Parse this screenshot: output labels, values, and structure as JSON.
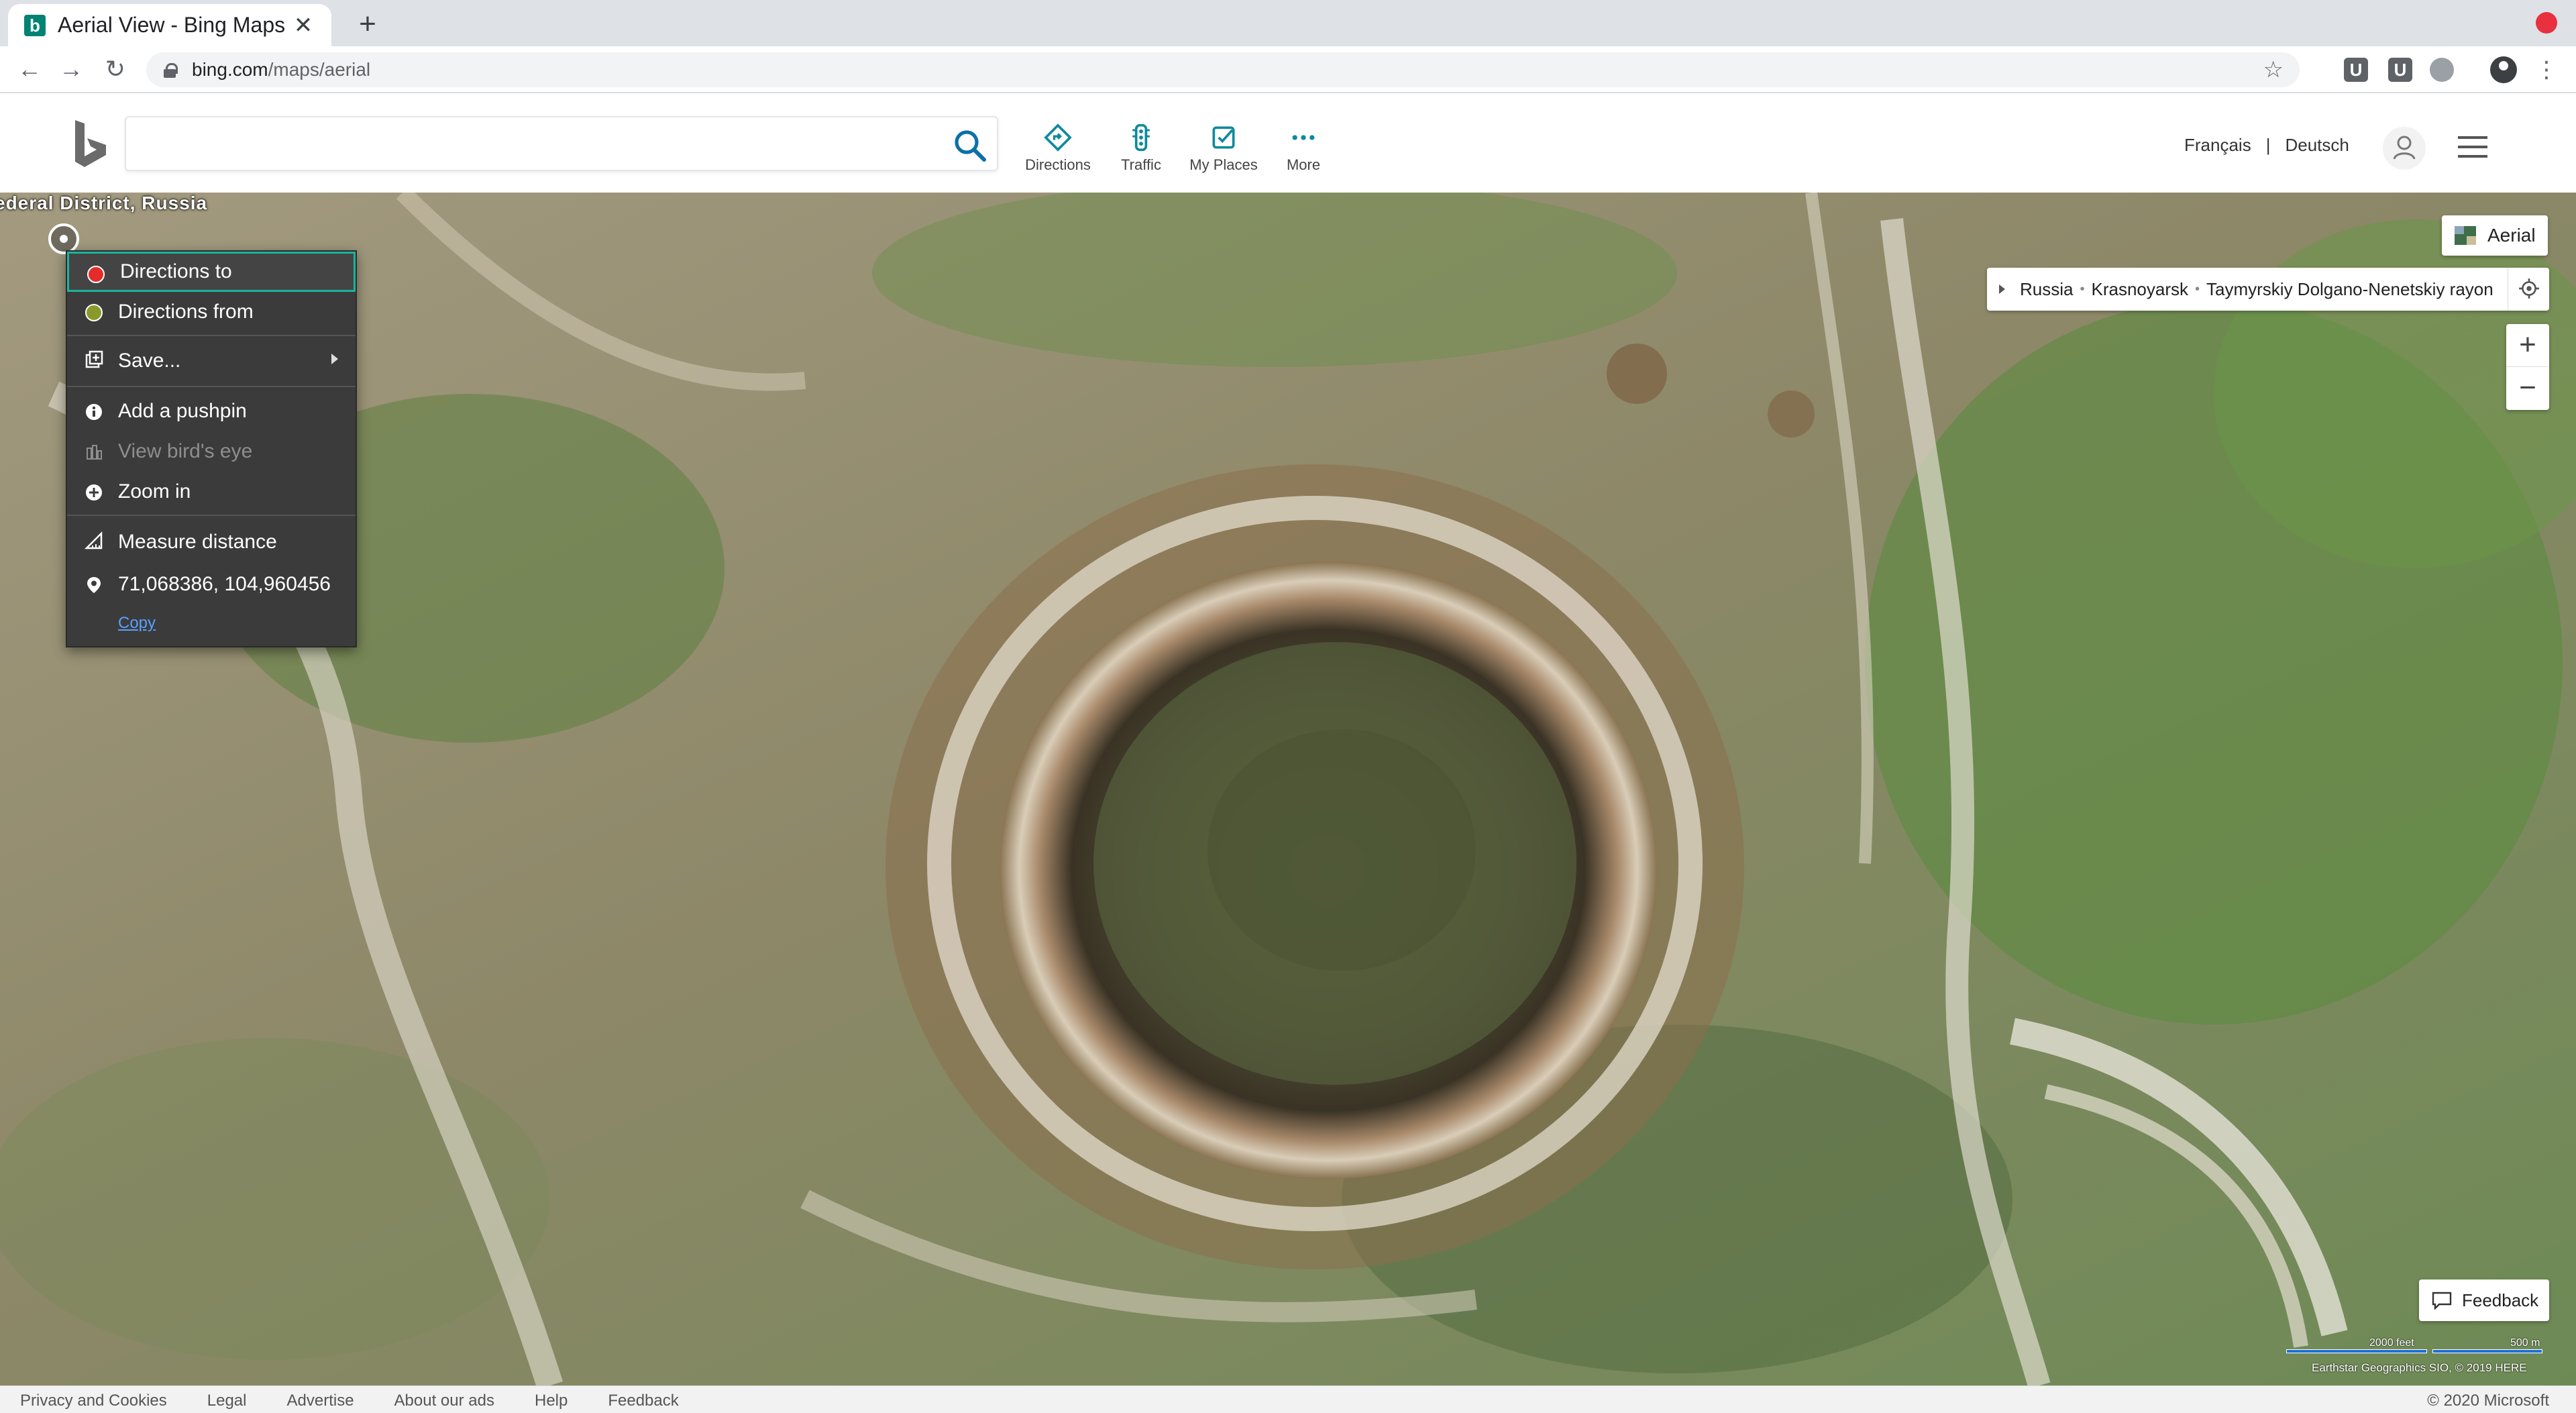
{
  "browser": {
    "tab_title": "Aerial View - Bing Maps",
    "tab_favicon": "b",
    "new_tab_icon": "plus-icon",
    "url_host": "bing.com",
    "url_path": "/maps/aerial",
    "extensions": [
      "U",
      "U"
    ]
  },
  "header": {
    "search_placeholder": "",
    "nav": [
      {
        "label": "Directions",
        "icon": "directions-icon"
      },
      {
        "label": "Traffic",
        "icon": "traffic-icon"
      },
      {
        "label": "My Places",
        "icon": "my-places-icon"
      },
      {
        "label": "More",
        "icon": "more-icon"
      }
    ],
    "languages": [
      "Français",
      "|",
      "Deutsch"
    ]
  },
  "map": {
    "region_label": "ederal District, Russia",
    "view_mode": "Aerial",
    "breadcrumb": [
      "Russia",
      "Krasnoyarsk",
      "Taymyrskiy Dolgano-Nenetskiy rayon"
    ],
    "breadcrumb_separator": "•",
    "zoom_in": "+",
    "zoom_out": "−",
    "feedback": "Feedback",
    "scale_label_1": "2000 feet",
    "scale_label_2": "500 m",
    "attribution": "Earthstar Geographics SIO, © 2019 HERE"
  },
  "context_menu": {
    "items": [
      {
        "label": "Directions to",
        "icon": "red-dot-icon"
      },
      {
        "label": "Directions from",
        "icon": "green-dot-icon"
      },
      {
        "label": "Save...",
        "icon": "save-icon"
      },
      {
        "label": "Add a pushpin",
        "icon": "info-icon"
      },
      {
        "label": "View bird's eye",
        "icon": "birds-eye-icon"
      },
      {
        "label": "Zoom in",
        "icon": "zoom-in-icon"
      },
      {
        "label": "Measure distance",
        "icon": "ruler-icon"
      },
      {
        "label": "71,068386, 104,960456",
        "icon": "location-pin-icon"
      }
    ],
    "copy_link": "Copy"
  },
  "footer": {
    "links": [
      "Privacy and Cookies",
      "Legal",
      "Advertise",
      "About our ads",
      "Help",
      "Feedback"
    ],
    "copyright": "© 2020 Microsoft"
  },
  "colors": {
    "accent": "#008373",
    "menu_bg": "#3b3b3b",
    "menu_focus_border": "#1bb59c",
    "directions_to_dot": "#e52b2b",
    "directions_from_dot": "#8a9a2a",
    "nav_icon": "#0e8a9c"
  }
}
